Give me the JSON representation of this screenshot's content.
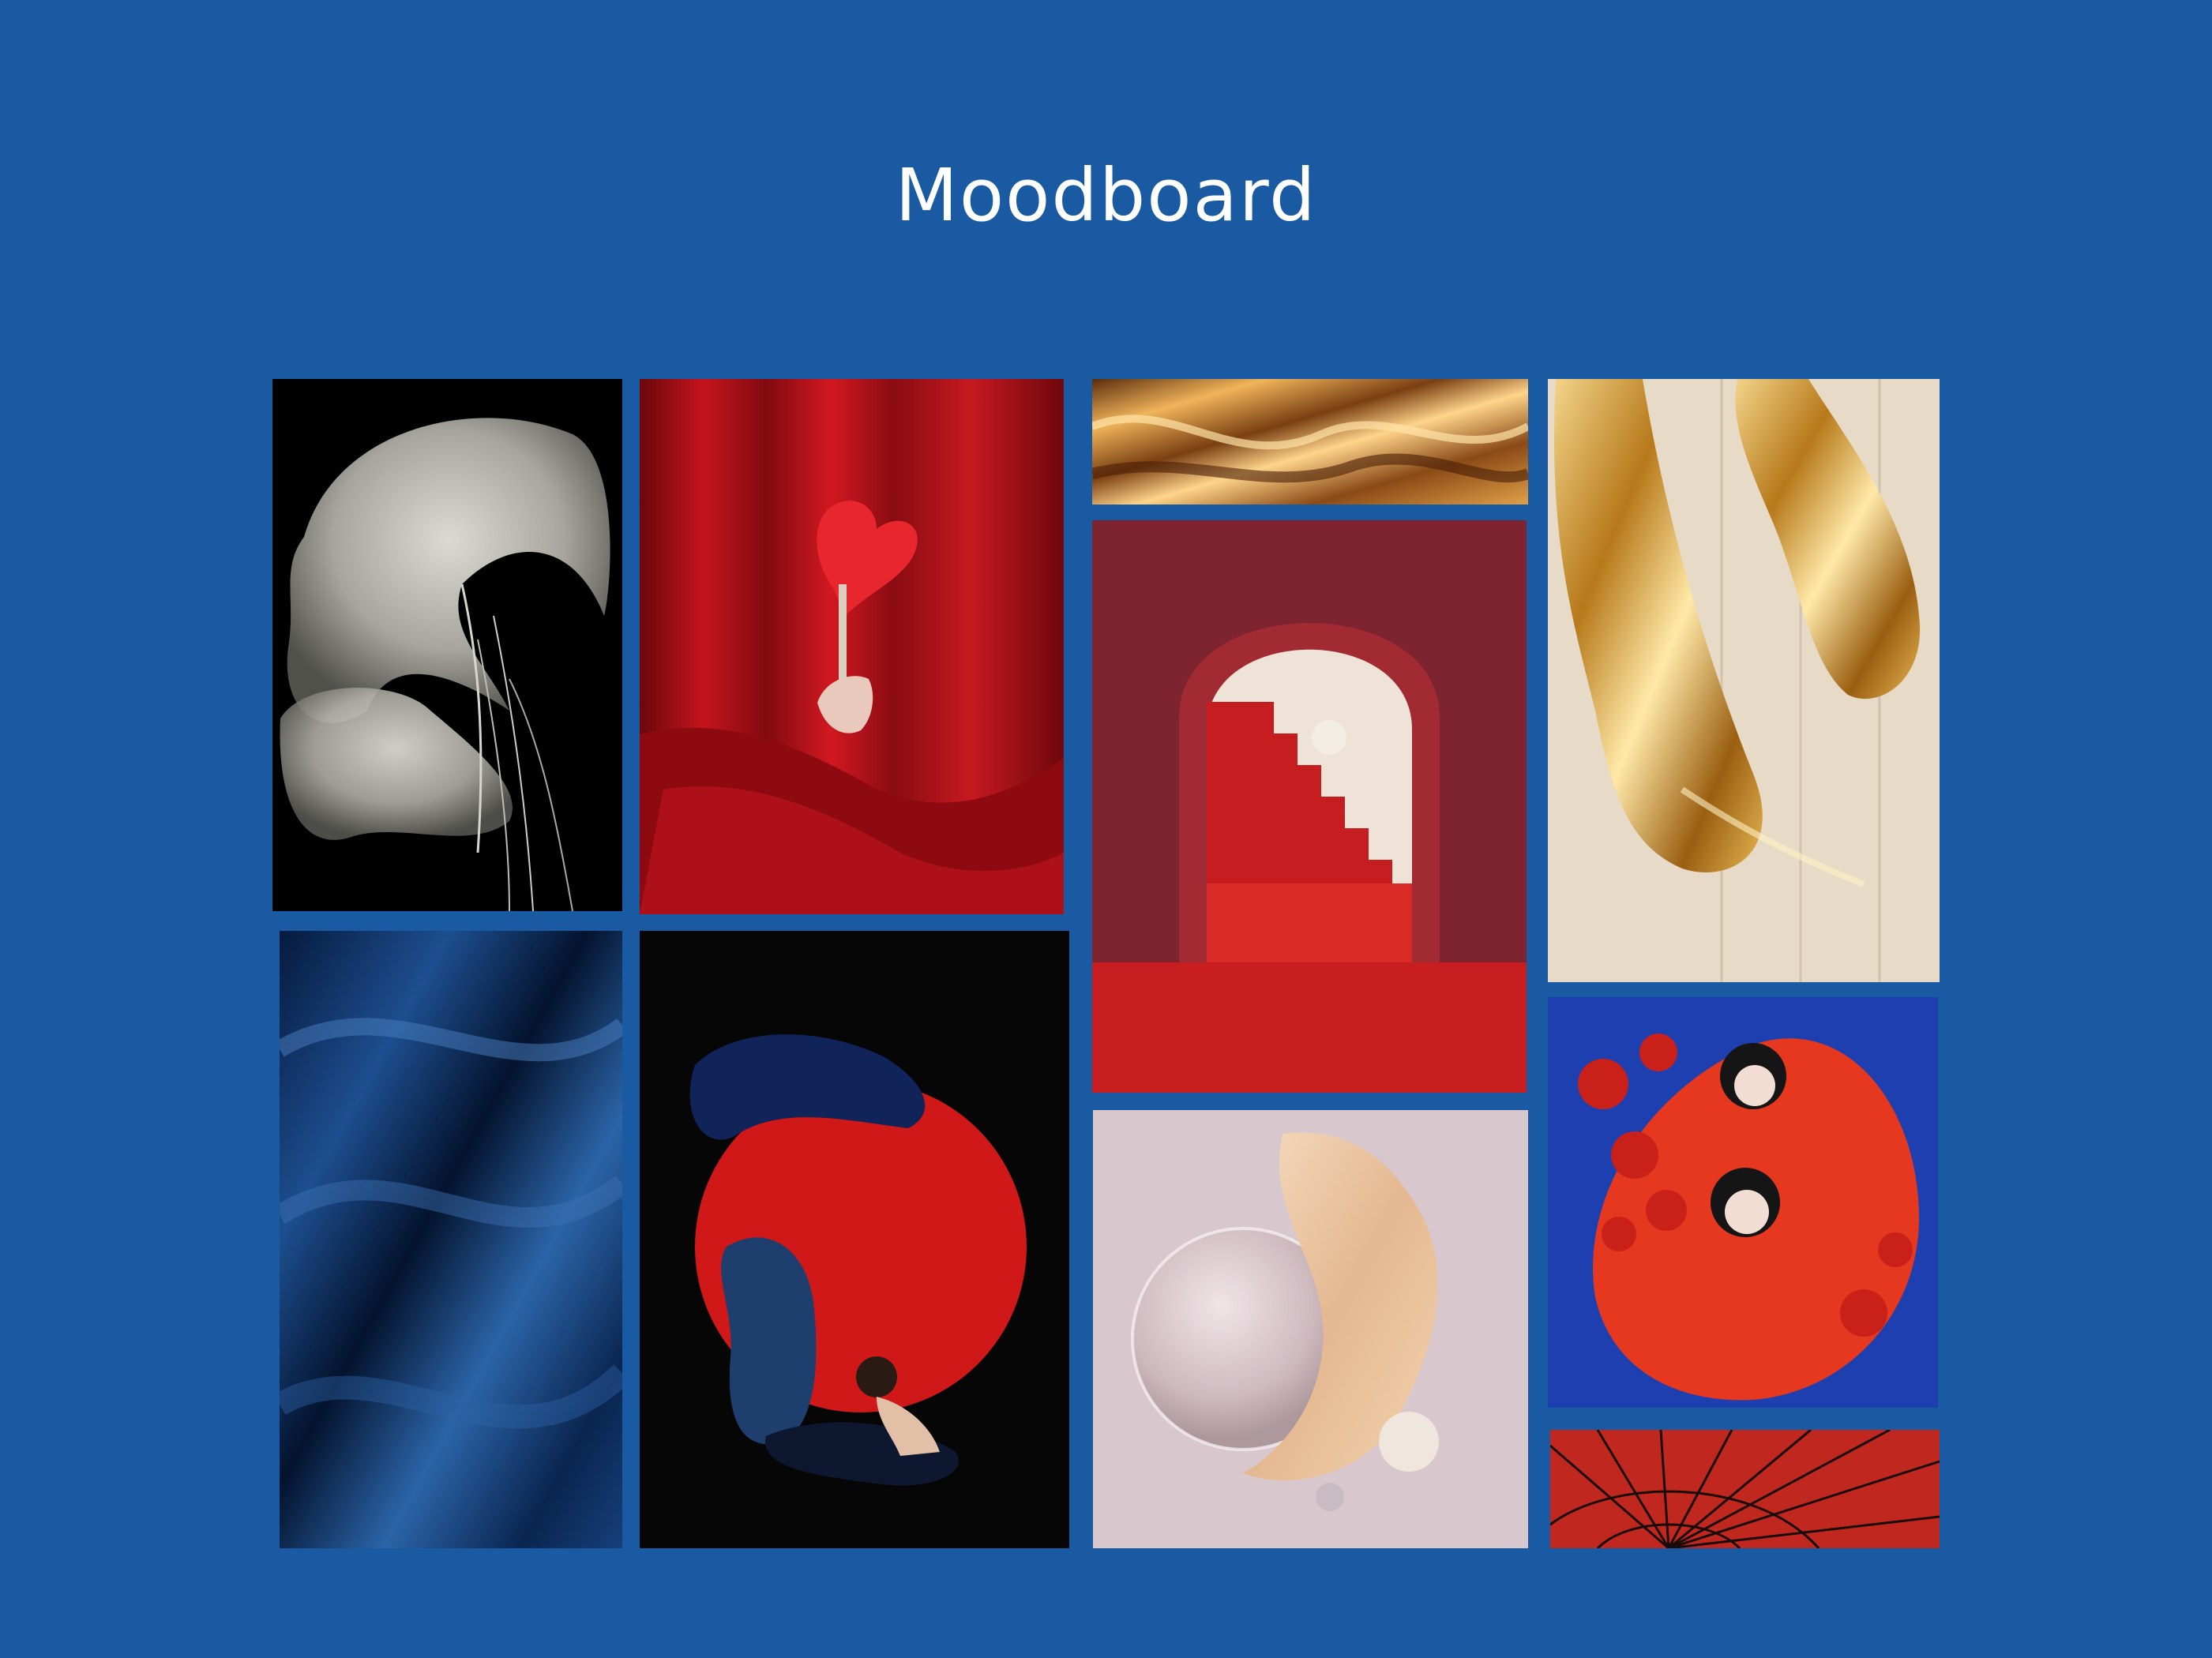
{
  "page": {
    "title": "Moodboard",
    "background_color": "#1a5aa2",
    "title_color": "#ffffff"
  },
  "tiles": [
    {
      "name": "white-organza-flower",
      "palette": [
        "#000000",
        "#e8e6dc"
      ]
    },
    {
      "name": "red-curtain-anthurium",
      "palette": [
        "#7a0a10",
        "#e5232c"
      ]
    },
    {
      "name": "gold-silk-fabric",
      "palette": [
        "#6a3a12",
        "#e8a24a"
      ]
    },
    {
      "name": "red-arch-staircase",
      "palette": [
        "#7e2530",
        "#d42624"
      ]
    },
    {
      "name": "gold-liquid-shoes",
      "palette": [
        "#e6d8c4",
        "#d4a13a"
      ]
    },
    {
      "name": "blue-satin-fabric",
      "palette": [
        "#051a40",
        "#2a5ea0"
      ]
    },
    {
      "name": "red-circle-figures",
      "palette": [
        "#050505",
        "#d01818"
      ]
    },
    {
      "name": "glass-sphere-silk",
      "palette": [
        "#d9c9ce",
        "#e8c8a8"
      ]
    },
    {
      "name": "red-flowers-figures",
      "palette": [
        "#1d3fb0",
        "#e5381f"
      ]
    },
    {
      "name": "red-paper-umbrella",
      "palette": [
        "#b5241e",
        "#1a0a0a"
      ]
    }
  ]
}
